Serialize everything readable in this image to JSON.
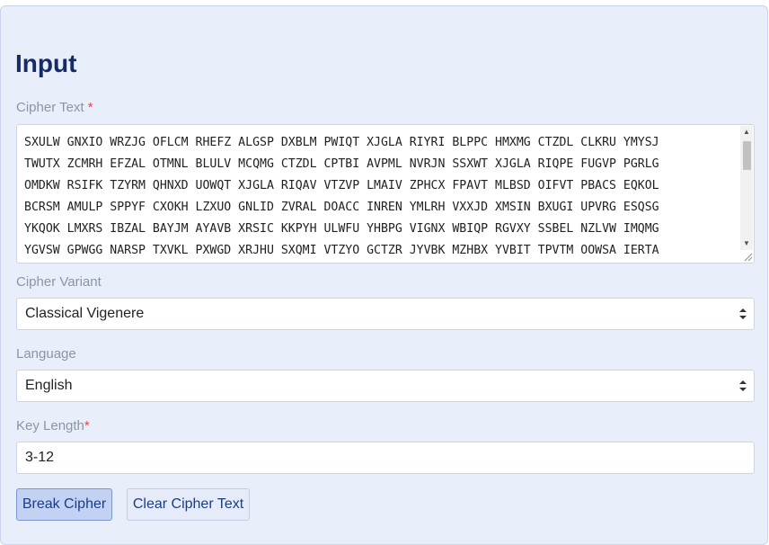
{
  "section_title": "Input",
  "cipher_text": {
    "label": "Cipher Text",
    "required_mark": "*",
    "value": "SXULW GNXIO WRZJG OFLCM RHEFZ ALGSP DXBLM PWIQT XJGLA RIYRI BLPPC HMXMG CTZDL CLKRU YMYSJ\nTWUTX ZCMRH EFZAL OTMNL BLULV MCQMG CTZDL CPTBI AVPML NVRJN SSXWT XJGLA RIQPE FUGVP PGRLG\nOMDKW RSIFK TZYRM QHNXD UOWQT XJGLA RIQAV VTZVP LMAIV ZPHCX FPAVT MLBSD OIFVT PBACS EQKOL\nBCRSM AMULP SPPYF CXOKH LZXUO GNLID ZVRAL DOACC INREN YMLRH VXXJD XMSIN BXUGI UPVRG ESQSG\nYKQOK LMXRS IBZAL BAYJM AYAVB XRSIC KKPYH ULWFU YHBPG VIGNX WBIQP RGVXY SSBEL NZLVW IMQMG\nYGVSW GPWGG NARSP TXVKL PXWGD XRJHU SXQMI VTZYO GCTZR JYVBK MZHBX YVBIT TPVTM OOWSA IERTA"
  },
  "cipher_variant": {
    "label": "Cipher Variant",
    "value": "Classical Vigenere"
  },
  "language": {
    "label": "Language",
    "value": "English"
  },
  "key_length": {
    "label": "Key Length",
    "required_mark": "*",
    "value": "3-12"
  },
  "buttons": {
    "break": "Break Cipher",
    "clear": "Clear Cipher Text"
  },
  "colors": {
    "panel_background": "#e9eefb",
    "title": "#152a66",
    "required": "#e0484d",
    "primary_button": "#c3d1f3"
  },
  "icons": {
    "select_arrow": "chevron-up-down-icon",
    "resize": "resize-grip-icon"
  }
}
